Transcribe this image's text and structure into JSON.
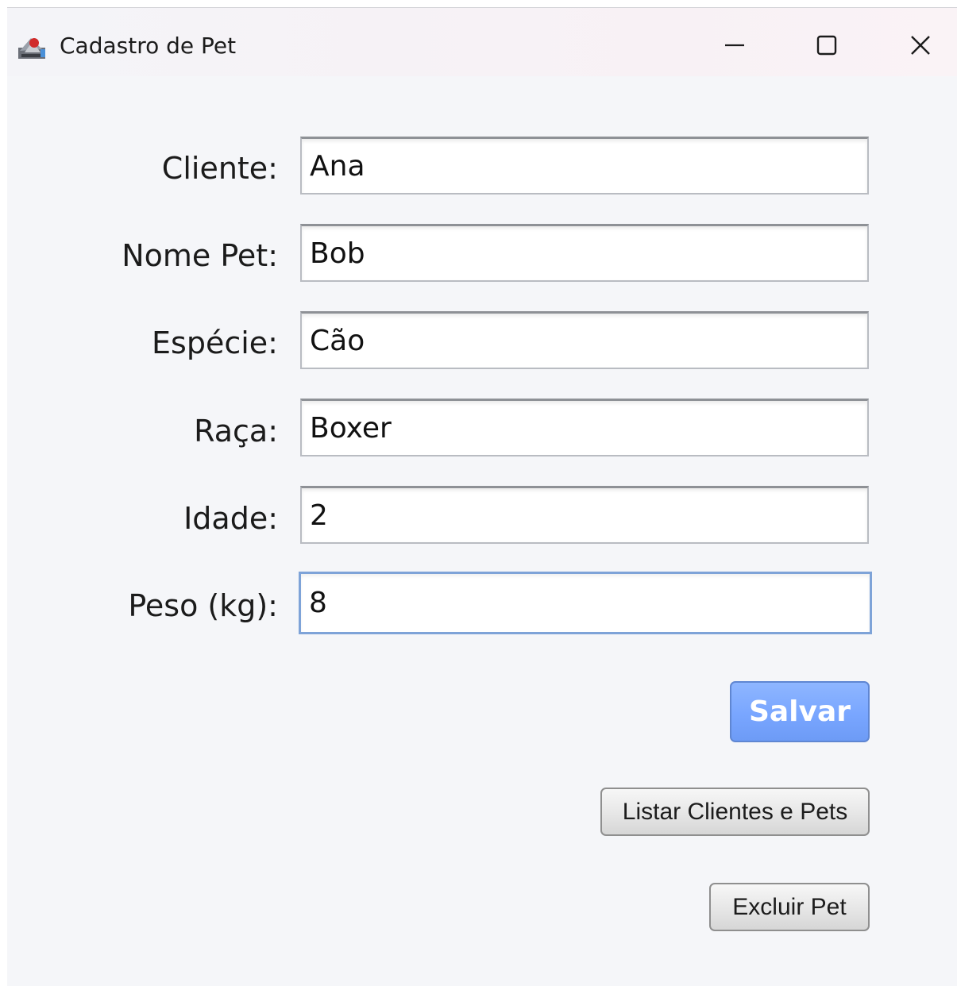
{
  "window": {
    "title": "Cadastro de Pet",
    "controls": {
      "minimize": "minimize-icon",
      "maximize": "maximize-icon",
      "close": "close-icon"
    }
  },
  "form": {
    "fields": [
      {
        "label": "Cliente:",
        "value": "Ana"
      },
      {
        "label": "Nome Pet:",
        "value": "Bob"
      },
      {
        "label": "Espécie:",
        "value": "Cão"
      },
      {
        "label": "Raça:",
        "value": "Boxer"
      },
      {
        "label": "Idade:",
        "value": "2"
      },
      {
        "label": "Peso (kg):",
        "value": "8"
      }
    ]
  },
  "buttons": {
    "save": "Salvar",
    "list": "Listar Clientes e Pets",
    "delete": "Excluir Pet"
  },
  "colors": {
    "primary_button": "#79a6ff",
    "focus_border": "#7ea3d8"
  }
}
